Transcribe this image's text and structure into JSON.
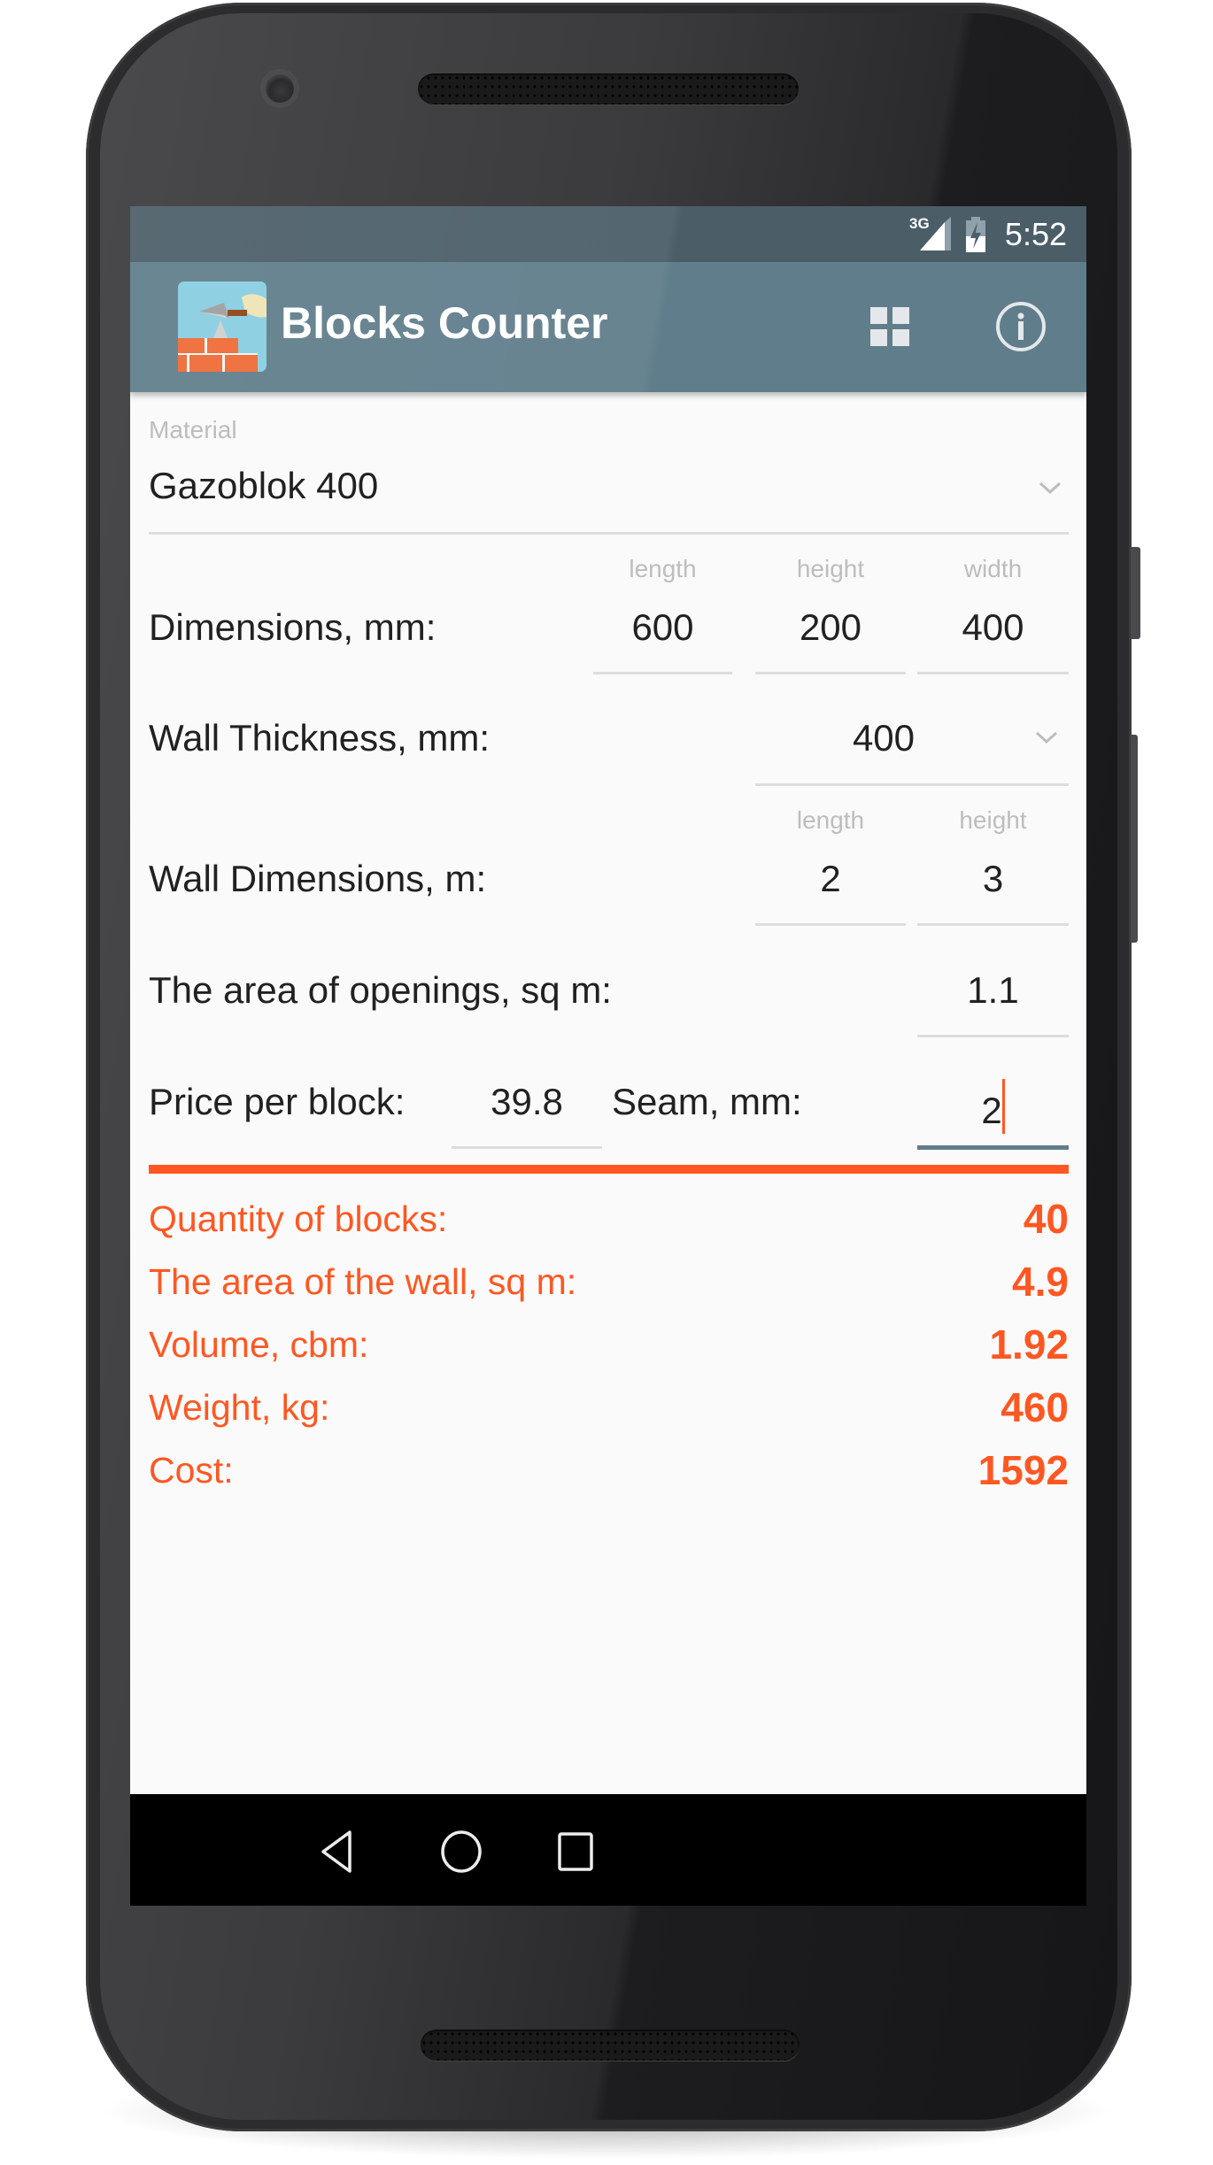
{
  "status_bar": {
    "network": "3G",
    "time": "5:52"
  },
  "toolbar": {
    "title": "Blocks Counter",
    "actions": [
      {
        "icon": "grid-icon",
        "label": "Materials grid"
      },
      {
        "icon": "info-icon",
        "label": "Info"
      }
    ]
  },
  "material": {
    "label": "Material",
    "value": "Gazoblok 400"
  },
  "dimensions": {
    "label": "Dimensions, mm:",
    "fields": [
      {
        "hint": "length",
        "value": "600"
      },
      {
        "hint": "height",
        "value": "200"
      },
      {
        "hint": "width",
        "value": "400"
      }
    ]
  },
  "wall_thickness": {
    "label": "Wall Thickness, mm:",
    "value": "400"
  },
  "wall_dimensions": {
    "label": "Wall Dimensions, m:",
    "fields": [
      {
        "hint": "length",
        "value": "2"
      },
      {
        "hint": "height",
        "value": "3"
      }
    ]
  },
  "openings": {
    "label": "The area of openings, sq m:",
    "value": "1.1"
  },
  "price": {
    "label": "Price per block:",
    "value": "39.8"
  },
  "seam": {
    "label": "Seam, mm:",
    "value": "2"
  },
  "results": [
    {
      "label": "Quantity of blocks:",
      "value": "40"
    },
    {
      "label": "The area of the wall, sq m:",
      "value": "4.9"
    },
    {
      "label": "Volume, cbm:",
      "value": "1.92"
    },
    {
      "label": "Weight, kg:",
      "value": "460"
    },
    {
      "label": "Cost:",
      "value": "1592"
    }
  ],
  "nav_bar": {
    "buttons": [
      "back",
      "home",
      "recents"
    ]
  },
  "colors": {
    "primary": "#607D8B",
    "primary_dark": "#4B5E68",
    "accent": "#FF5722",
    "background": "#FAFAFA"
  }
}
